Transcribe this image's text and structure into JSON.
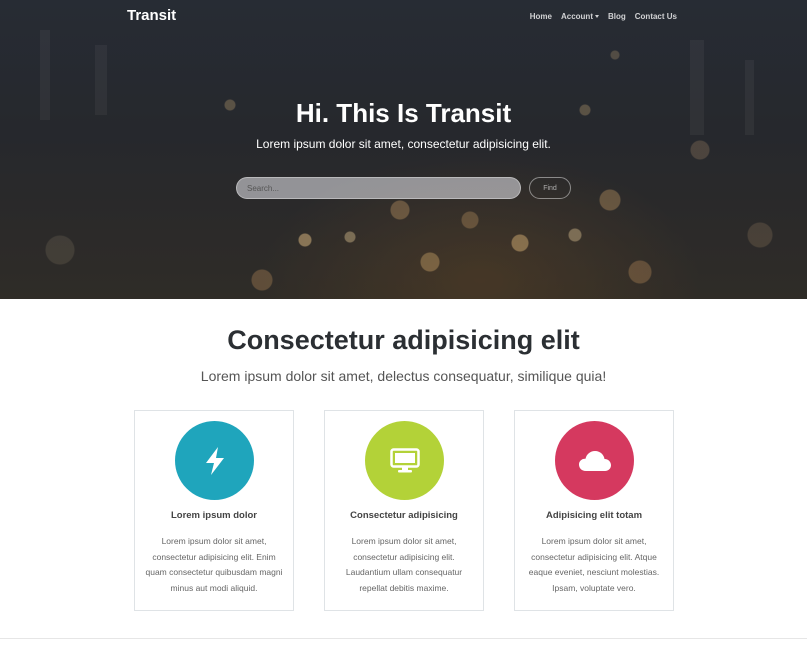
{
  "navbar": {
    "brand": "Transit",
    "links": [
      "Home",
      "Account",
      "Blog",
      "Contact Us"
    ]
  },
  "hero": {
    "title": "Hi. This Is Transit",
    "subtitle": "Lorem ipsum dolor sit amet, consectetur adipisicing elit.",
    "search": {
      "placeholder": "Search...",
      "value": ""
    },
    "find_label": "Find"
  },
  "features": {
    "title": "Consectetur adipisicing elit",
    "subtitle": "Lorem ipsum dolor sit amet, delectus consequatur, similique quia!",
    "cards": [
      {
        "icon": "lightning-bolt-icon",
        "color": "#1fa5bc",
        "title": "Lorem ipsum dolor",
        "text": "Lorem ipsum dolor sit amet, consectetur adipisicing elit. Enim quam consectetur quibusdam magni minus aut modi aliquid."
      },
      {
        "icon": "desktop-monitor-icon",
        "color": "#b3d238",
        "title": "Consectetur adipisicing",
        "text": "Lorem ipsum dolor sit amet, consectetur adipisicing elit. Laudantium ullam consequatur repellat debitis maxime."
      },
      {
        "icon": "cloud-icon",
        "color": "#d5395f",
        "title": "Adipisicing elit totam",
        "text": "Lorem ipsum dolor sit amet, consectetur adipisicing elit. Atque eaque eveniet, nesciunt molestias. Ipsam, voluptate vero."
      }
    ]
  }
}
